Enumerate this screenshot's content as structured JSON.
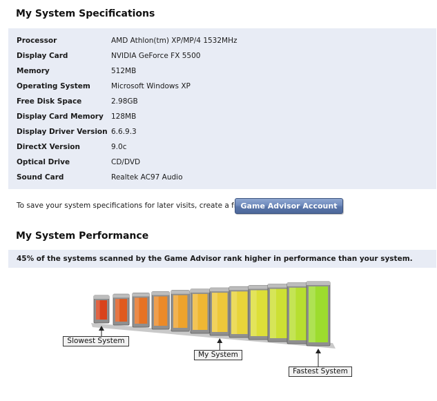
{
  "specs": {
    "title": "My System Specifications",
    "rows": [
      {
        "label": "Processor",
        "value": "AMD Athlon(tm) XP/MP/4 1532MHz"
      },
      {
        "label": "Display Card",
        "value": "NVIDIA GeForce FX 5500"
      },
      {
        "label": "Memory",
        "value": "512MB"
      },
      {
        "label": "Operating System",
        "value": "Microsoft Windows XP"
      },
      {
        "label": "Free Disk Space",
        "value": "2.98GB"
      },
      {
        "label": "Display Card Memory",
        "value": "128MB"
      },
      {
        "label": "Display Driver Version",
        "value": "6.6.9.3"
      },
      {
        "label": "DirectX Version",
        "value": "9.0c"
      },
      {
        "label": "Optical Drive",
        "value": "CD/DVD"
      },
      {
        "label": "Sound Card",
        "value": "Realtek AC97 Audio"
      }
    ]
  },
  "save": {
    "text": "To save your system specifications for later visits, create a free",
    "button_label": "Game Advisor Account"
  },
  "performance": {
    "title": "My System Performance",
    "summary": "45% of the systems scanned by the Game Advisor rank higher in performance than your system.",
    "percent_higher": 45,
    "bar_count": 12,
    "bar_colors": [
      "#d9431c",
      "#e05a1e",
      "#e67224",
      "#ec8a28",
      "#eea32c",
      "#efb733",
      "#eec83a",
      "#e8d43a",
      "#dddf38",
      "#cde034",
      "#b7df30",
      "#9ddc2e"
    ],
    "markers": {
      "slowest": {
        "label": "Slowest System",
        "bar_index": 0
      },
      "mine": {
        "label": "My System",
        "bar_index": 6
      },
      "fastest": {
        "label": "Fastest System",
        "bar_index": 11
      }
    }
  }
}
